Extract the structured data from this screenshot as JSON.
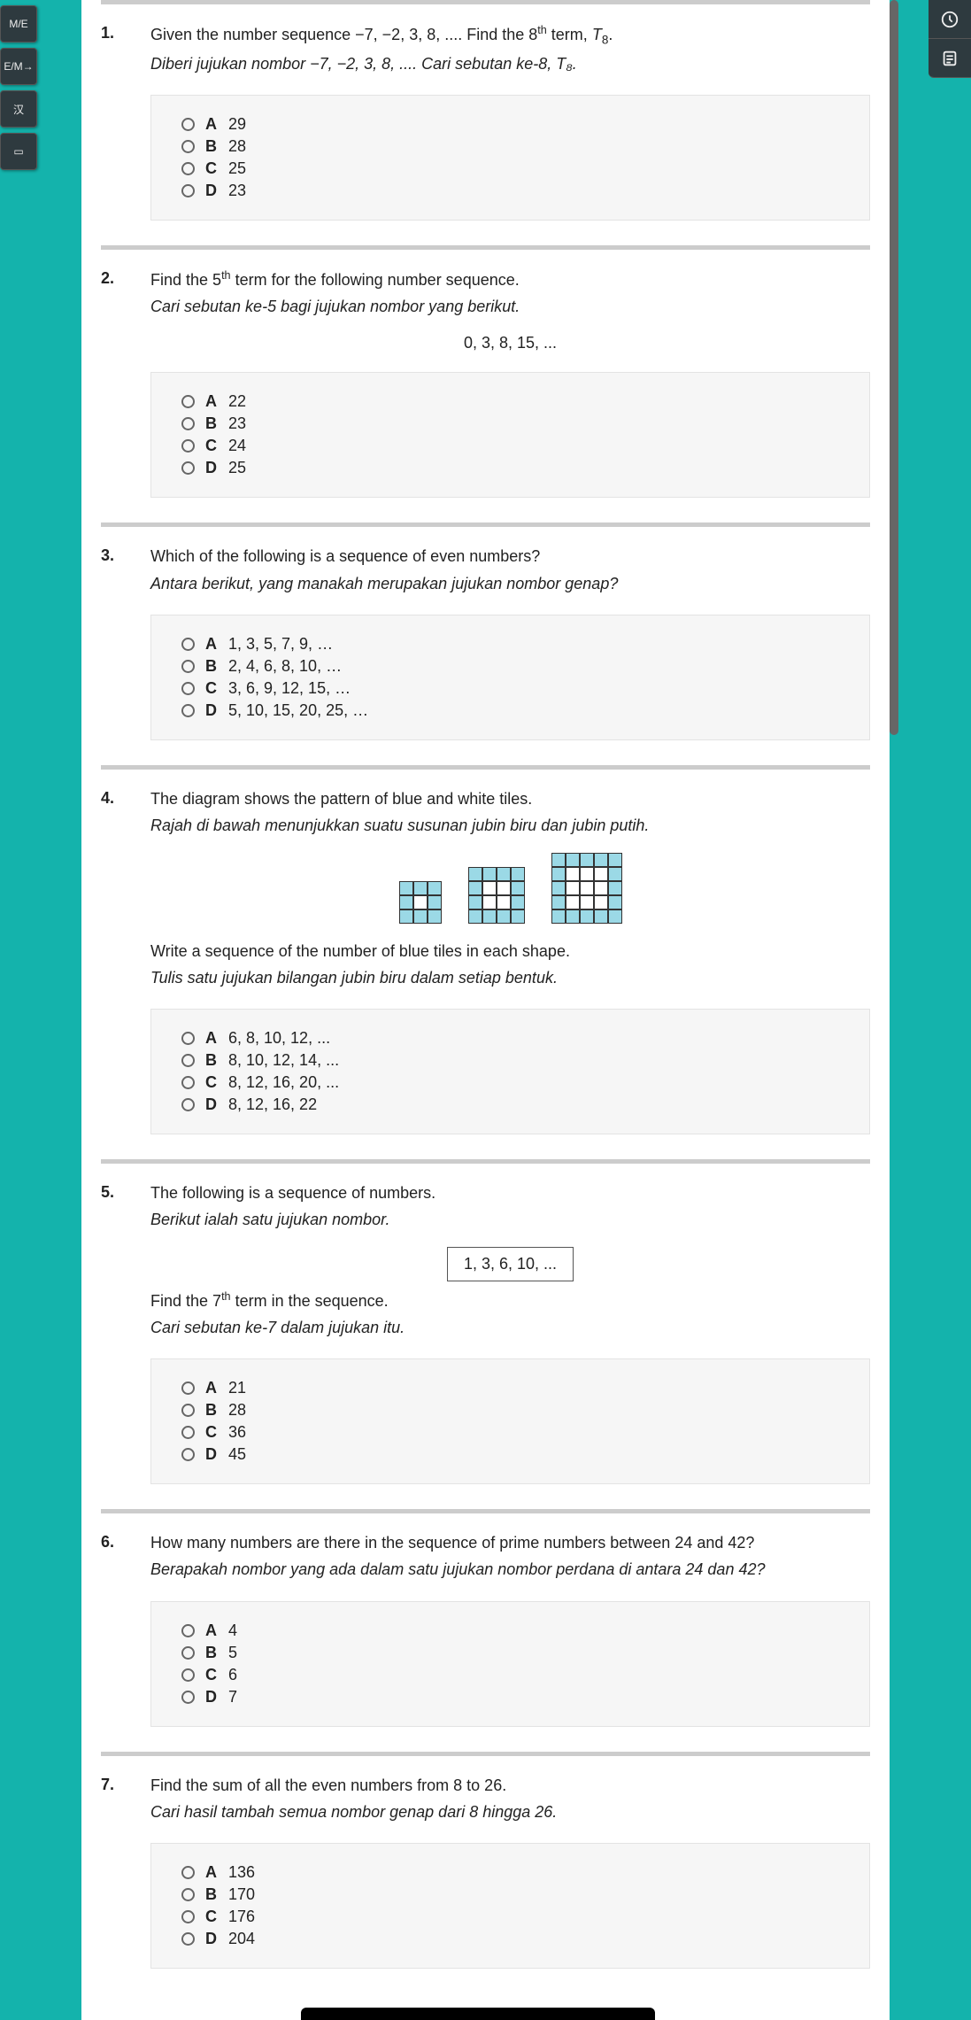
{
  "sidebar_left": [
    "M/E",
    "E/M→",
    "汉",
    "▭"
  ],
  "sidebar_right": [
    "clock-icon",
    "notes-icon"
  ],
  "questions": [
    {
      "num": "1.",
      "en_a": "Given the number sequence −7, −2, 3, 8, .... Find the 8",
      "en_sup": "th",
      "en_b": " term, ",
      "en_var": "T",
      "en_sub": "8",
      "en_c": ".",
      "ms": "Diberi jujukan nombor −7, −2, 3, 8, .... Cari sebutan ke-8, T₈.",
      "options": [
        {
          "letter": "A",
          "text": "29"
        },
        {
          "letter": "B",
          "text": "28"
        },
        {
          "letter": "C",
          "text": "25"
        },
        {
          "letter": "D",
          "text": "23"
        }
      ]
    },
    {
      "num": "2.",
      "en_a": "Find the 5",
      "en_sup": "th",
      "en_b": " term for the following number sequence.",
      "ms": "Cari sebutan ke-5 bagi jujukan nombor yang berikut.",
      "seq": "0, 3, 8, 15, ...",
      "options": [
        {
          "letter": "A",
          "text": "22"
        },
        {
          "letter": "B",
          "text": "23"
        },
        {
          "letter": "C",
          "text": "24"
        },
        {
          "letter": "D",
          "text": "25"
        }
      ]
    },
    {
      "num": "3.",
      "en": "Which of the following is a sequence of even numbers?",
      "ms": "Antara berikut, yang manakah merupakan jujukan nombor genap?",
      "options": [
        {
          "letter": "A",
          "text": "1, 3, 5, 7, 9, …"
        },
        {
          "letter": "B",
          "text": "2, 4, 6, 8, 10, …"
        },
        {
          "letter": "C",
          "text": "3, 6, 9, 12, 15, …"
        },
        {
          "letter": "D",
          "text": "5, 10, 15, 20, 25, …"
        }
      ]
    },
    {
      "num": "4.",
      "en": "The diagram shows the pattern of blue and white tiles.",
      "ms": "Rajah di bawah menunjukkan suatu susunan jubin biru dan jubin putih.",
      "en2": "Write a sequence of the number of blue tiles in each shape.",
      "ms2": "Tulis satu jujukan bilangan jubin biru dalam setiap bentuk.",
      "options": [
        {
          "letter": "A",
          "text": "6, 8, 10, 12, ..."
        },
        {
          "letter": "B",
          "text": "8, 10, 12, 14, ..."
        },
        {
          "letter": "C",
          "text": "8, 12, 16, 20, ..."
        },
        {
          "letter": "D",
          "text": "8, 12, 16, 22"
        }
      ]
    },
    {
      "num": "5.",
      "en": "The following is a sequence of numbers.",
      "ms": "Berikut ialah satu jujukan nombor.",
      "boxed": "1, 3, 6, 10, ...",
      "en2_a": "Find the 7",
      "en2_sup": "th",
      "en2_b": " term in the sequence.",
      "ms2": "Cari sebutan ke-7 dalam jujukan itu.",
      "options": [
        {
          "letter": "A",
          "text": "21"
        },
        {
          "letter": "B",
          "text": "28"
        },
        {
          "letter": "C",
          "text": "36"
        },
        {
          "letter": "D",
          "text": "45"
        }
      ]
    },
    {
      "num": "6.",
      "en": "How many numbers are there in the sequence of prime numbers between 24 and 42?",
      "ms": "Berapakah nombor yang ada dalam satu jujukan nombor perdana di antara 24 dan 42?",
      "options": [
        {
          "letter": "A",
          "text": "4"
        },
        {
          "letter": "B",
          "text": "5"
        },
        {
          "letter": "C",
          "text": "6"
        },
        {
          "letter": "D",
          "text": "7"
        }
      ]
    },
    {
      "num": "7.",
      "en": "Find the sum of all the even numbers from 8 to 26.",
      "ms": "Cari hasil tambah semua nombor genap dari 8 hingga 26.",
      "options": [
        {
          "letter": "A",
          "text": "136"
        },
        {
          "letter": "B",
          "text": "170"
        },
        {
          "letter": "C",
          "text": "176"
        },
        {
          "letter": "D",
          "text": "204"
        }
      ]
    }
  ]
}
